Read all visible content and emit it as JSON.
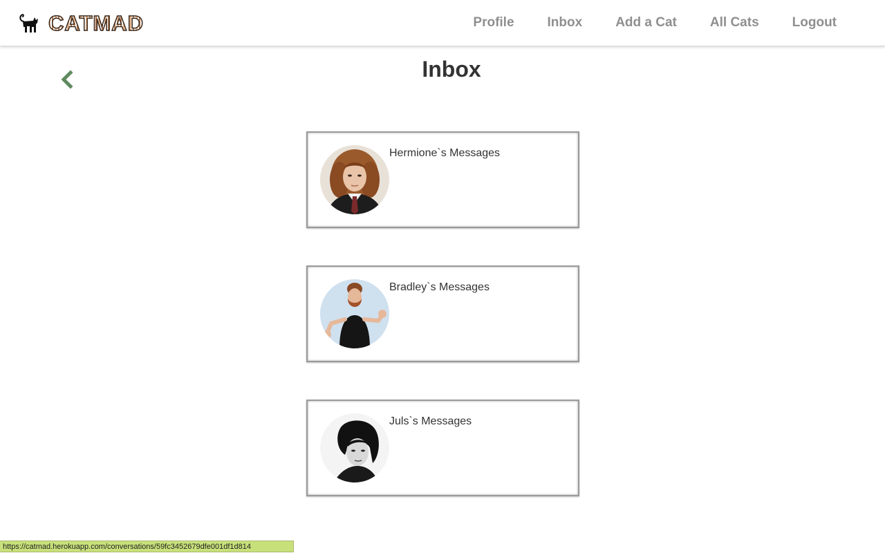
{
  "brand": {
    "logo_text": "CATMAD",
    "cat_icon": "black-cat-icon"
  },
  "nav": {
    "items": [
      {
        "label": "Profile"
      },
      {
        "label": "Inbox"
      },
      {
        "label": "Add a Cat"
      },
      {
        "label": "All Cats"
      },
      {
        "label": "Logout"
      }
    ]
  },
  "page": {
    "title": "Inbox",
    "back_icon": "chevron-left-icon"
  },
  "conversations": [
    {
      "label": "Hermione`s Messages"
    },
    {
      "label": "Bradley`s Messages"
    },
    {
      "label": "Juls`s Messages"
    }
  ],
  "status_bar": {
    "url": "https://catmad.herokuapp.com/conversations/59fc3452679dfe001df1d814"
  },
  "colors": {
    "nav_text": "#8f8f8f",
    "title_text": "#333333",
    "chevron": "#5e8a5e",
    "status_bar_bg": "#c8e07a"
  }
}
